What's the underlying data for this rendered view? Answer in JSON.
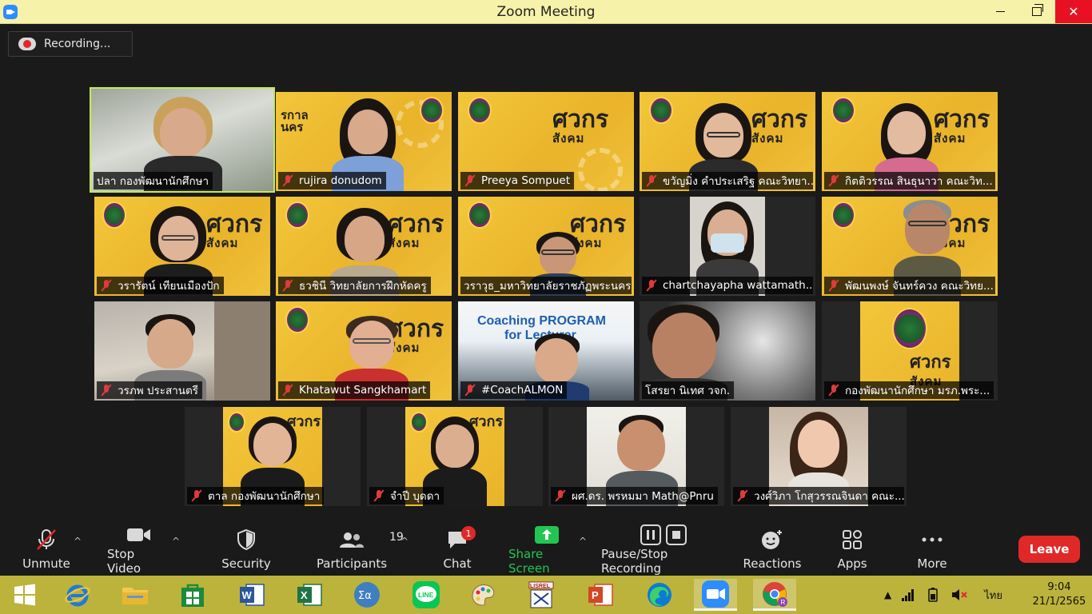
{
  "window": {
    "title": "Zoom Meeting"
  },
  "recording": {
    "label": "Recording..."
  },
  "participants_tiles": [
    {
      "name": "ปลา  กองพัฒนานักศึกษา",
      "muted": false
    },
    {
      "name": "rujira donudom",
      "muted": true
    },
    {
      "name": "Preeya Sompuet",
      "muted": true
    },
    {
      "name": "ขวัญมิ่ง คำประเสริฐ คณะวิทยา...",
      "muted": true
    },
    {
      "name": "กิตติวรรณ สินธุนาวา คณะวิท...",
      "muted": true
    },
    {
      "name": "วรารัตน์ เทียนเมืองปัก",
      "muted": true
    },
    {
      "name": "ธวชินี  วิทยาลัยการฝึกหัดครู",
      "muted": true
    },
    {
      "name": "วราวุธ_มหาวิทยาลัยราชภัฏพระนคร",
      "muted": false
    },
    {
      "name": "chartchayapha wattamath...",
      "muted": true
    },
    {
      "name": "พัฒนพงษ์ จันทร์ควง คณะวิทย...",
      "muted": true
    },
    {
      "name": "วรภพ ประสานตรี",
      "muted": true
    },
    {
      "name": "Khatawut Sangkhamart",
      "muted": true
    },
    {
      "name": "#CoachALMON",
      "muted": true
    },
    {
      "name": "โสรยา นิเทศ วจก.",
      "muted": false
    },
    {
      "name": "กองพัฒนานักศึกษา มรภ.พระ...",
      "muted": true
    },
    {
      "name": "ตาล กองพัฒนานักศึกษา",
      "muted": true
    },
    {
      "name": "จำปี บุดดา",
      "muted": true
    },
    {
      "name": "ผศ.ดร. พรหมมา Math@Pnru",
      "muted": true
    },
    {
      "name": "วงศ์วิภา โกสุวรรณจินดา คณะ...",
      "muted": true
    }
  ],
  "brand_text": {
    "line1": "ศวกร",
    "line2": "สังคม",
    "coach": "Coaching PROGRAM",
    "coach2": "for Lecturer"
  },
  "toolbar": {
    "unmute": "Unmute",
    "stop_video": "Stop Video",
    "security": "Security",
    "participants": "Participants",
    "participants_count": "19",
    "chat": "Chat",
    "chat_badge": "1",
    "share_screen": "Share Screen",
    "pause_stop_recording": "Pause/Stop Recording",
    "reactions": "Reactions",
    "apps": "Apps",
    "more": "More",
    "leave": "Leave"
  },
  "taskbar": {
    "language": "ไทย",
    "time": "9:04",
    "date": "21/1/2565",
    "icons": [
      "windows-start-icon",
      "internet-explorer-icon",
      "file-explorer-icon",
      "store-icon",
      "word-icon",
      "excel-icon",
      "math-input-icon",
      "line-icon",
      "paint-icon",
      "lisrel-icon",
      "powerpoint-icon",
      "edge-icon",
      "zoom-icon",
      "chrome-icon"
    ]
  },
  "colors": {
    "accent_active": "#c4e85a",
    "leave": "#e02828",
    "share": "#23c552",
    "titlebar": "#f7f2a9",
    "taskbar": "#bcb33c"
  }
}
